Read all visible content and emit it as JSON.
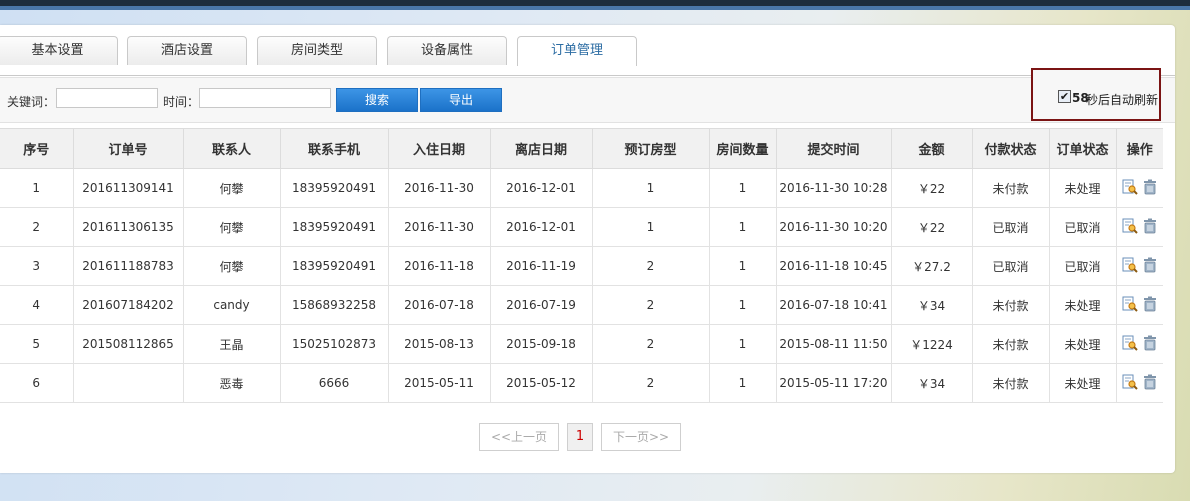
{
  "tabs": [
    {
      "label": "基本设置",
      "active": false
    },
    {
      "label": "酒店设置",
      "active": false
    },
    {
      "label": "房间类型",
      "active": false
    },
    {
      "label": "设备属性",
      "active": false
    },
    {
      "label": "订单管理",
      "active": true
    }
  ],
  "toolbar": {
    "keyword_label": "关键词：",
    "keyword_value": "",
    "time_label": "时间：",
    "time_value": "",
    "search_label": "搜索",
    "export_label": "导出"
  },
  "auto_refresh": {
    "checked": true,
    "seconds": "58",
    "text": "秒后自动刷新"
  },
  "table": {
    "headers": [
      "序号",
      "订单号",
      "联系人",
      "联系手机",
      "入住日期",
      "离店日期",
      "预订房型",
      "房间数量",
      "提交时间",
      "金额",
      "付款状态",
      "订单状态",
      "操作"
    ],
    "rows": [
      [
        "1",
        "201611309141",
        "何攀",
        "18395920491",
        "2016-11-30",
        "2016-12-01",
        "1",
        "1",
        "2016-11-30 10:28",
        "￥22",
        "未付款",
        "未处理"
      ],
      [
        "2",
        "201611306135",
        "何攀",
        "18395920491",
        "2016-11-30",
        "2016-12-01",
        "1",
        "1",
        "2016-11-30 10:20",
        "￥22",
        "已取消",
        "已取消"
      ],
      [
        "3",
        "201611188783",
        "何攀",
        "18395920491",
        "2016-11-18",
        "2016-11-19",
        "2",
        "1",
        "2016-11-18 10:45",
        "￥27.2",
        "已取消",
        "已取消"
      ],
      [
        "4",
        "201607184202",
        "candy",
        "15868932258",
        "2016-07-18",
        "2016-07-19",
        "2",
        "1",
        "2016-07-18 10:41",
        "￥34",
        "未付款",
        "未处理"
      ],
      [
        "5",
        "201508112865",
        "王晶",
        "15025102873",
        "2015-08-13",
        "2015-09-18",
        "2",
        "1",
        "2015-08-11 11:50",
        "￥1224",
        "未付款",
        "未处理"
      ],
      [
        "6",
        "",
        "恶毒",
        "6666",
        "2015-05-11",
        "2015-05-12",
        "2",
        "1",
        "2015-05-11 17:20",
        "￥34",
        "未付款",
        "未处理"
      ]
    ],
    "row_action_icons": [
      "view-icon",
      "trash-icon"
    ]
  },
  "pager": {
    "prev_label": "<<上一页",
    "current_page": "1",
    "next_label": "下一页>>"
  },
  "colors": {
    "accent_blue": "#1b72c9",
    "active_tab_text": "#2b6ca3",
    "highlight_border": "#7b1414",
    "current_page": "#cc0000"
  }
}
